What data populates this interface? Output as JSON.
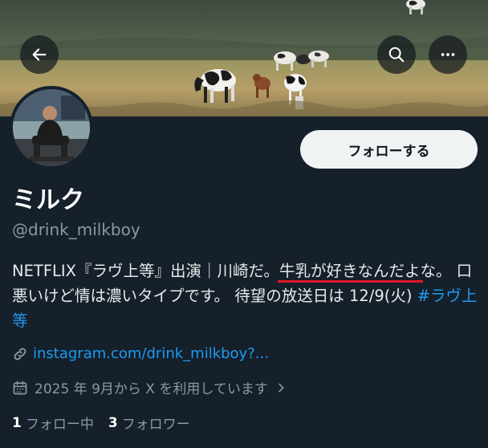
{
  "profile": {
    "display_name": "ミルク",
    "handle": "@drink_milkboy",
    "follow_button": "フォローする",
    "bio": {
      "part1": "NETFLIX『ラヴ上等』出演｜川崎だ。",
      "underlined": "牛乳が好きなんだよ",
      "part2": "な。 口悪いけど情は濃いタイプです。 待望の放送日は 12/9(火) ",
      "hashtag": "#ラヴ上等"
    },
    "link": "instagram.com/drink_milkboy?...",
    "joined": "2025 年 9月から X を利用しています",
    "following_count": "1",
    "following_label": "フォロー中",
    "followers_count": "3",
    "followers_label": "フォロワー"
  },
  "colors": {
    "background": "#15202b",
    "accent_link": "#1d9bf0",
    "underline": "#e0182b"
  },
  "icons": {
    "back": "arrow-left-icon",
    "search": "search-icon",
    "more": "more-horizontal-icon",
    "link": "link-icon",
    "calendar": "calendar-icon",
    "chevron": "chevron-right-icon"
  }
}
